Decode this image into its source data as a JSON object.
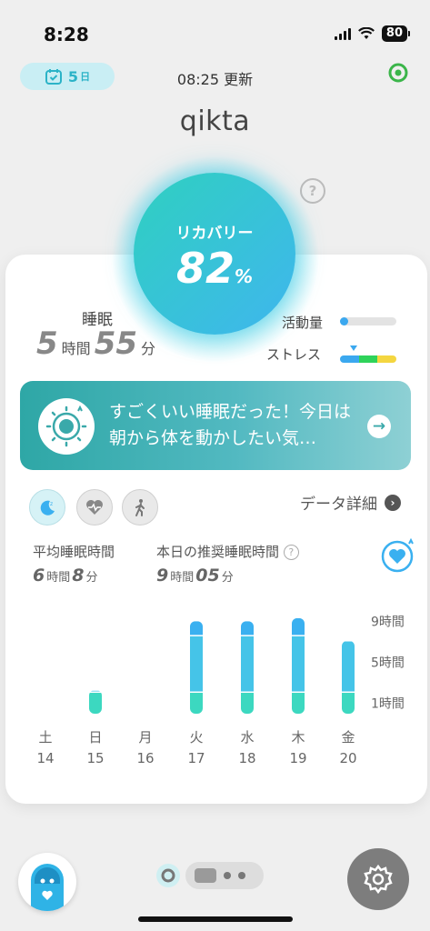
{
  "status_bar": {
    "time": "8:28",
    "battery": "80"
  },
  "header": {
    "day_count": "5",
    "day_unit": "日",
    "updated_text": "08:25 更新",
    "username": "qikta"
  },
  "recovery": {
    "label": "リカバリー",
    "value": "82",
    "unit": "%"
  },
  "sleep": {
    "label": "睡眠",
    "hours": "5",
    "hours_unit": "時間",
    "minutes": "55",
    "minutes_unit": "分"
  },
  "activity": {
    "label": "活動量",
    "level": 0.05
  },
  "stress": {
    "label": "ストレス",
    "colors": [
      "#3ba8ef",
      "#2fd35a",
      "#f4d640"
    ]
  },
  "banner": {
    "text": "すごくいい睡眠だった！今日は朝から体を動かしたい気…"
  },
  "tabs": {
    "data_detail": "データ詳細"
  },
  "stats": {
    "avg_label": "平均睡眠時間",
    "avg_hours": "6",
    "avg_hours_unit": "時間",
    "avg_minutes": "8",
    "avg_minutes_unit": "分",
    "rec_label": "本日の推奨睡眠時間",
    "rec_hours": "9",
    "rec_hours_unit": "時間",
    "rec_minutes": "05",
    "rec_minutes_unit": "分"
  },
  "chart_data": {
    "type": "bar",
    "categories": [
      "土 14",
      "日 15",
      "月 16",
      "火 17",
      "水 18",
      "木 19",
      "金 20"
    ],
    "weekdays": [
      "土",
      "日",
      "月",
      "火",
      "水",
      "木",
      "金"
    ],
    "dates": [
      "14",
      "15",
      "16",
      "17",
      "18",
      "19",
      "20"
    ],
    "values": [
      0,
      2.3,
      0,
      9.0,
      9.0,
      9.3,
      7.1
    ],
    "y_ticks": [
      {
        "value": 1,
        "label": "1時間"
      },
      {
        "value": 5,
        "label": "5時間"
      },
      {
        "value": 9,
        "label": "9時間"
      }
    ],
    "ylim": [
      0,
      10
    ],
    "colors": {
      "top": "#3ab0f0",
      "middle": "#45c4e8",
      "bottom": "#3cd8c0"
    }
  }
}
